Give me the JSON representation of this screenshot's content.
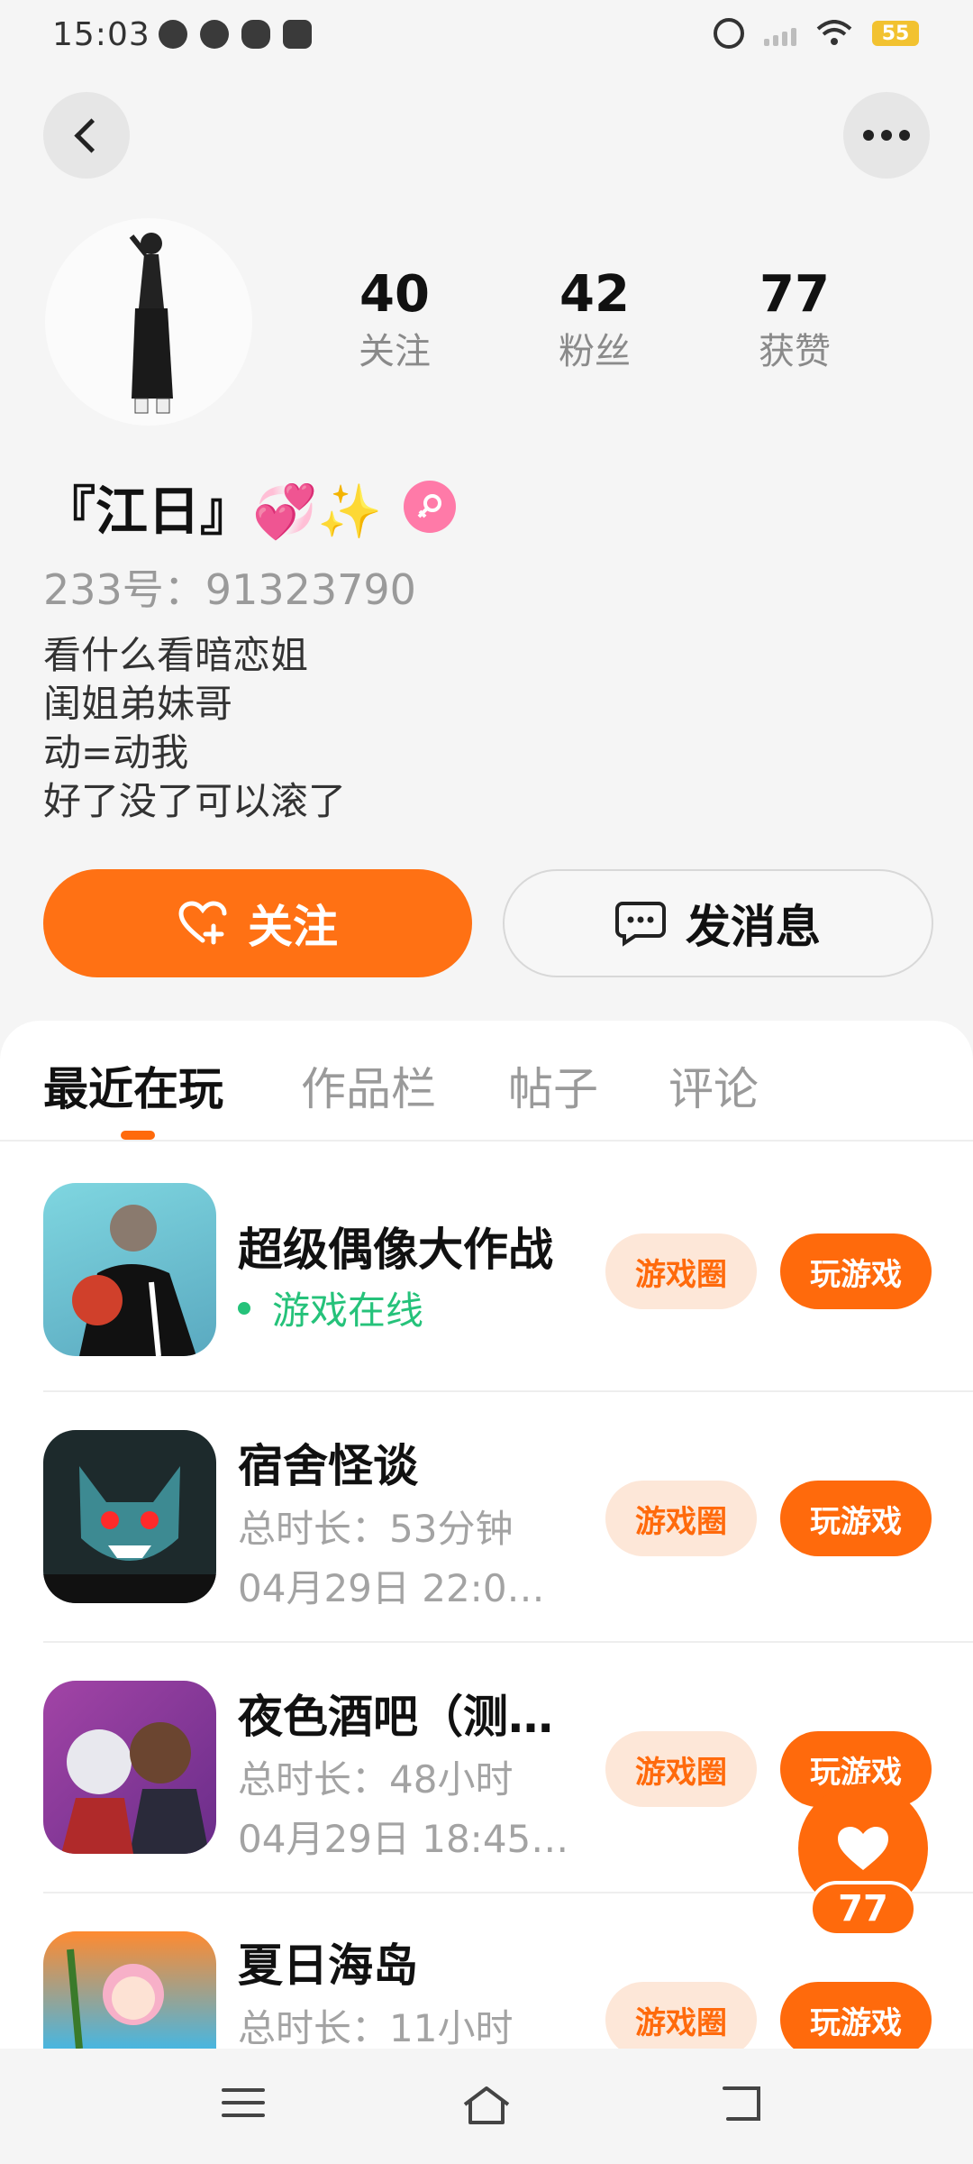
{
  "status_bar": {
    "time": "15:03",
    "battery": "55"
  },
  "profile": {
    "stats": [
      {
        "value": "40",
        "label": "关注"
      },
      {
        "value": "42",
        "label": "粉丝"
      },
      {
        "value": "77",
        "label": "获赞"
      }
    ],
    "nickname": "『江日』💞✨",
    "uid": "233号：91323790",
    "bio": [
      "看什么看暗恋姐",
      "闺姐弟妹哥",
      "动=动我",
      "好了没了可以滚了"
    ]
  },
  "actions": {
    "follow_label": "关注",
    "message_label": "发消息"
  },
  "tabs": [
    {
      "label": "最近在玩",
      "active": true
    },
    {
      "label": "作品栏",
      "active": false
    },
    {
      "label": "帖子",
      "active": false
    },
    {
      "label": "评论",
      "active": false
    }
  ],
  "games": [
    {
      "title": "超级偶像大作战",
      "status": "游戏在线",
      "circle_label": "游戏圈",
      "play_label": "玩游戏"
    },
    {
      "title": "宿舍怪谈",
      "duration": "总时长：53分钟",
      "last_played": "04月29日 22:0…",
      "circle_label": "游戏圈",
      "play_label": "玩游戏"
    },
    {
      "title": "夜色酒吧（测…",
      "duration": "总时长：48小时",
      "last_played": "04月29日 18:45…",
      "circle_label": "游戏圈",
      "play_label": "玩游戏"
    },
    {
      "title": "夏日海岛",
      "duration": "总时长：11小时",
      "circle_label": "游戏圈",
      "play_label": "玩游戏"
    }
  ],
  "like_fab": {
    "count": "77"
  },
  "colors": {
    "accent": "#ff6a0c",
    "online": "#25c27a"
  }
}
